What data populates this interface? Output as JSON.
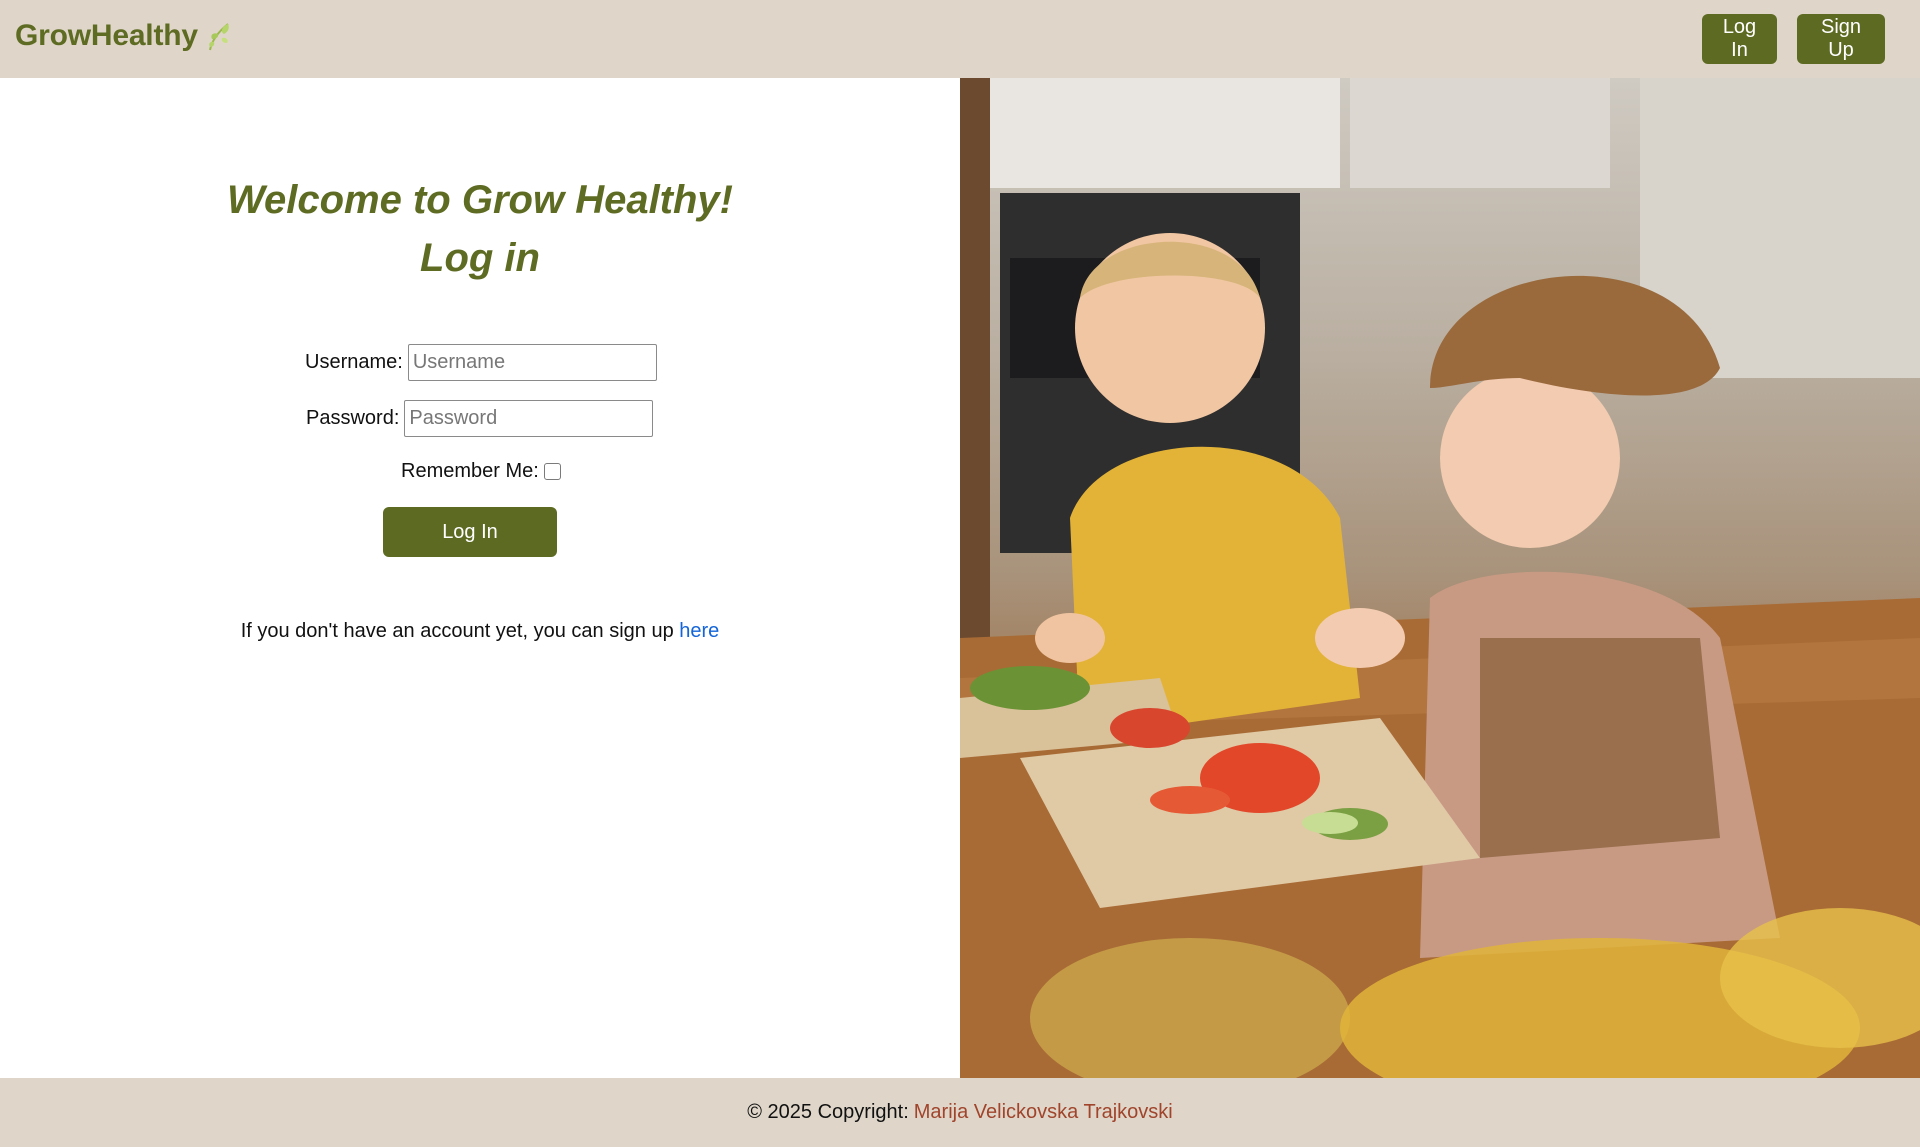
{
  "header": {
    "brand": "GrowHealthy",
    "login_label": "Log In",
    "signup_label": "Sign Up"
  },
  "main": {
    "title_line1": "Welcome to Grow Healthy!",
    "title_line2": "Log in",
    "username_label": "Username:",
    "username_placeholder": "Username",
    "username_value": "",
    "password_label": "Password:",
    "password_placeholder": "Password",
    "password_value": "",
    "remember_label": "Remember Me:",
    "remember_checked": false,
    "submit_label": "Log In",
    "signup_prompt": "If you don't have an account yet, you can sign up",
    "signup_link": "here"
  },
  "footer": {
    "copyright": "© 2025 Copyright:",
    "author": "Marija Velickovska Trajkovski"
  },
  "colors": {
    "brand": "#5e6b22",
    "header_bg": "#dfd6c9",
    "button_bg": "#5d6b22",
    "link": "#1565d8",
    "author": "#a0442c"
  },
  "icons": {
    "brand_icon": "leaf-icon"
  }
}
